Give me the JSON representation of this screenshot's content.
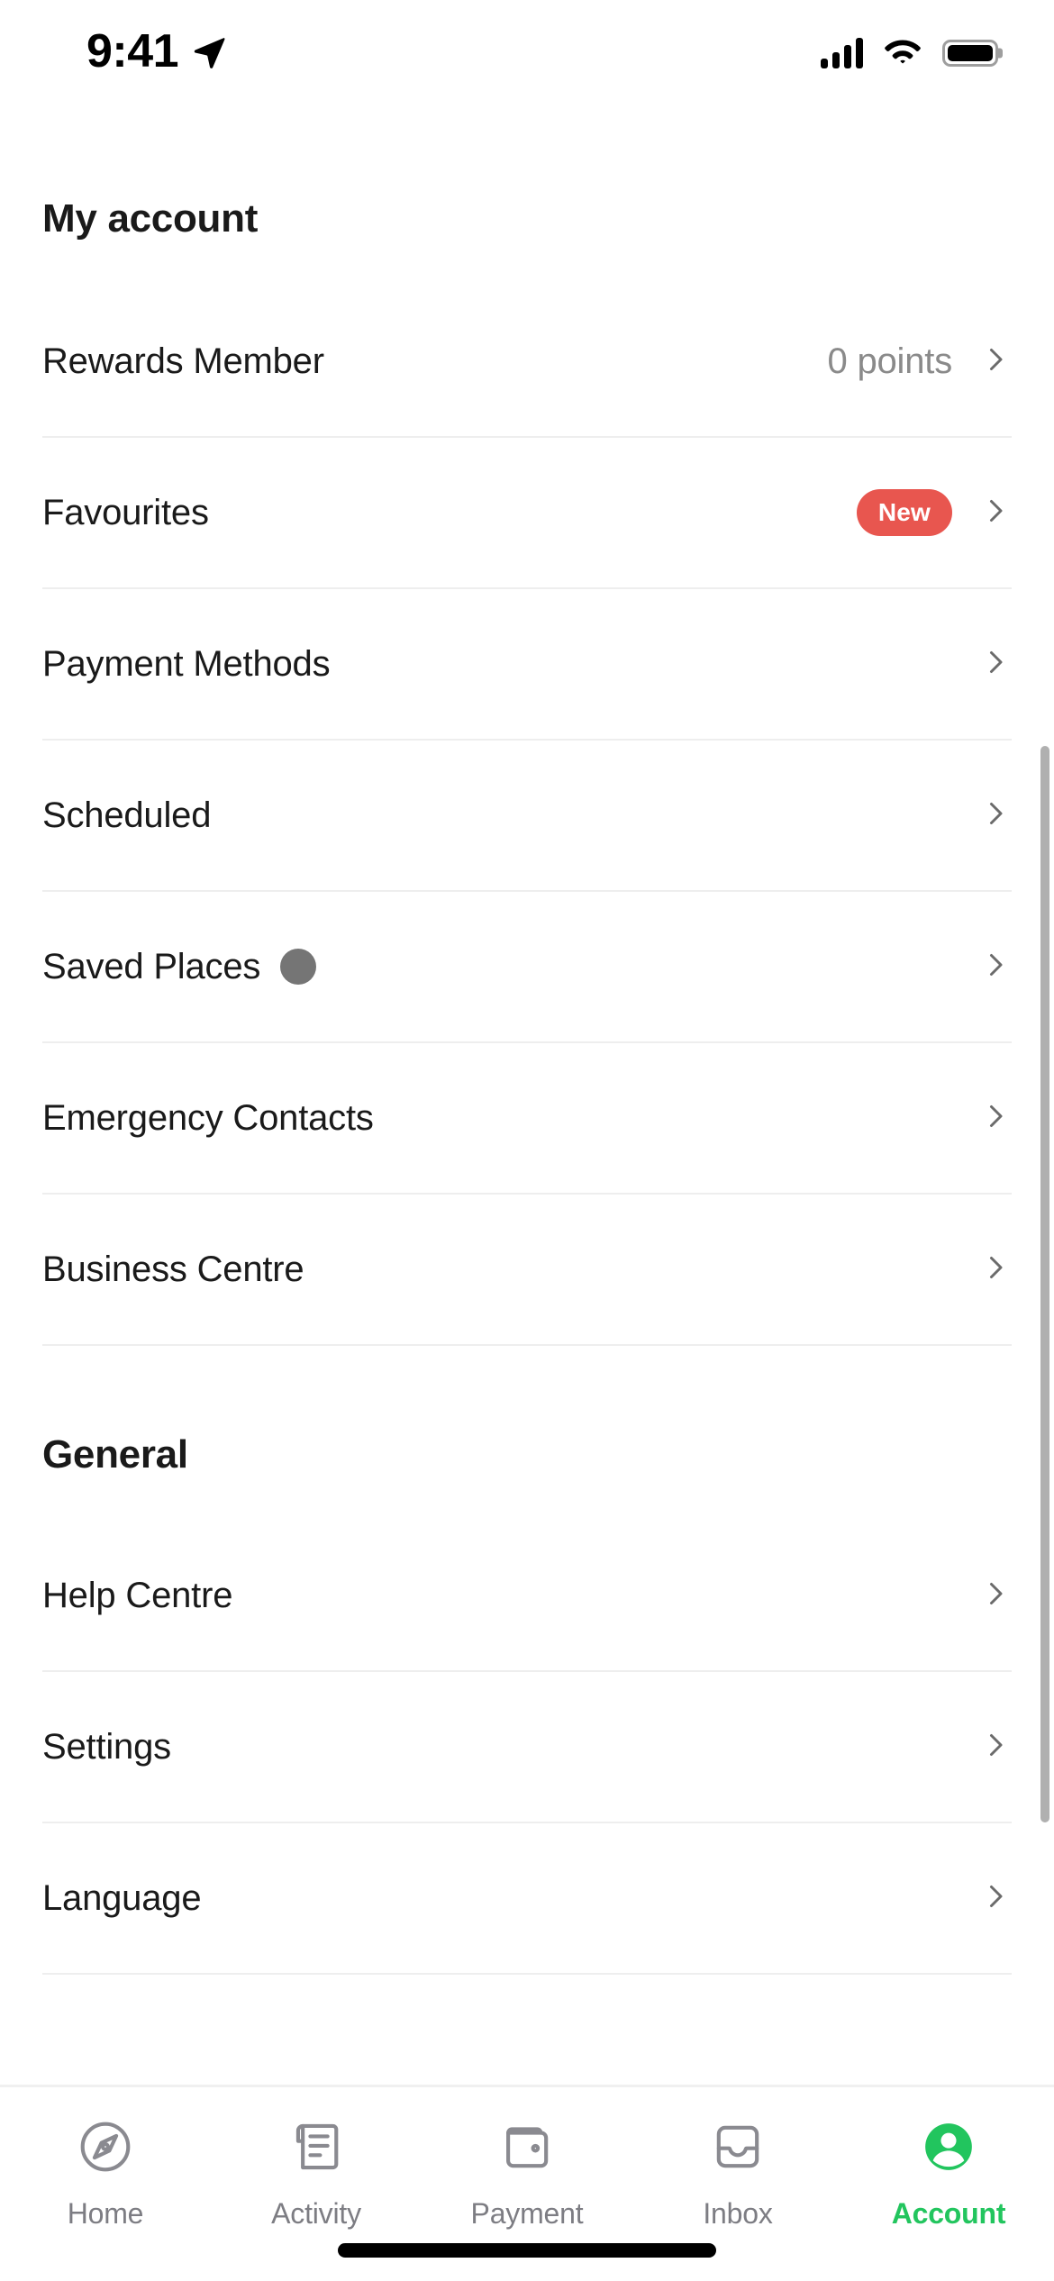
{
  "status_bar": {
    "time": "9:41",
    "location_icon": "location-arrow-icon",
    "cellular_icon": "cellular-signal-icon",
    "wifi_icon": "wifi-icon",
    "battery_icon": "battery-full-icon"
  },
  "accent_colors": {
    "active_tab": "#22c55e",
    "badge": "#e8564f",
    "divider": "#eeeeee",
    "muted_text": "#8a8a8a",
    "primary_text": "#1a1a1a",
    "dot": "#757575"
  },
  "sections": [
    {
      "title": "My account",
      "items": [
        {
          "label": "Rewards Member",
          "value": "0 points",
          "badge": null,
          "dot": false,
          "chevron": true
        },
        {
          "label": "Favourites",
          "value": null,
          "badge": "New",
          "dot": false,
          "chevron": true
        },
        {
          "label": "Payment Methods",
          "value": null,
          "badge": null,
          "dot": false,
          "chevron": true
        },
        {
          "label": "Scheduled",
          "value": null,
          "badge": null,
          "dot": false,
          "chevron": true
        },
        {
          "label": "Saved Places",
          "value": null,
          "badge": null,
          "dot": true,
          "chevron": true
        },
        {
          "label": "Emergency Contacts",
          "value": null,
          "badge": null,
          "dot": false,
          "chevron": true
        },
        {
          "label": "Business Centre",
          "value": null,
          "badge": null,
          "dot": false,
          "chevron": true
        }
      ]
    },
    {
      "title": "General",
      "items": [
        {
          "label": "Help Centre",
          "value": null,
          "badge": null,
          "dot": false,
          "chevron": true
        },
        {
          "label": "Settings",
          "value": null,
          "badge": null,
          "dot": false,
          "chevron": true
        },
        {
          "label": "Language",
          "value": null,
          "badge": null,
          "dot": false,
          "chevron": true
        }
      ]
    }
  ],
  "tabbar": {
    "tabs": [
      {
        "label": "Home",
        "icon": "compass-icon",
        "active": false
      },
      {
        "label": "Activity",
        "icon": "receipt-icon",
        "active": false
      },
      {
        "label": "Payment",
        "icon": "wallet-icon",
        "active": false
      },
      {
        "label": "Inbox",
        "icon": "inbox-tray-icon",
        "active": false
      },
      {
        "label": "Account",
        "icon": "account-avatar-icon",
        "active": true
      }
    ]
  }
}
